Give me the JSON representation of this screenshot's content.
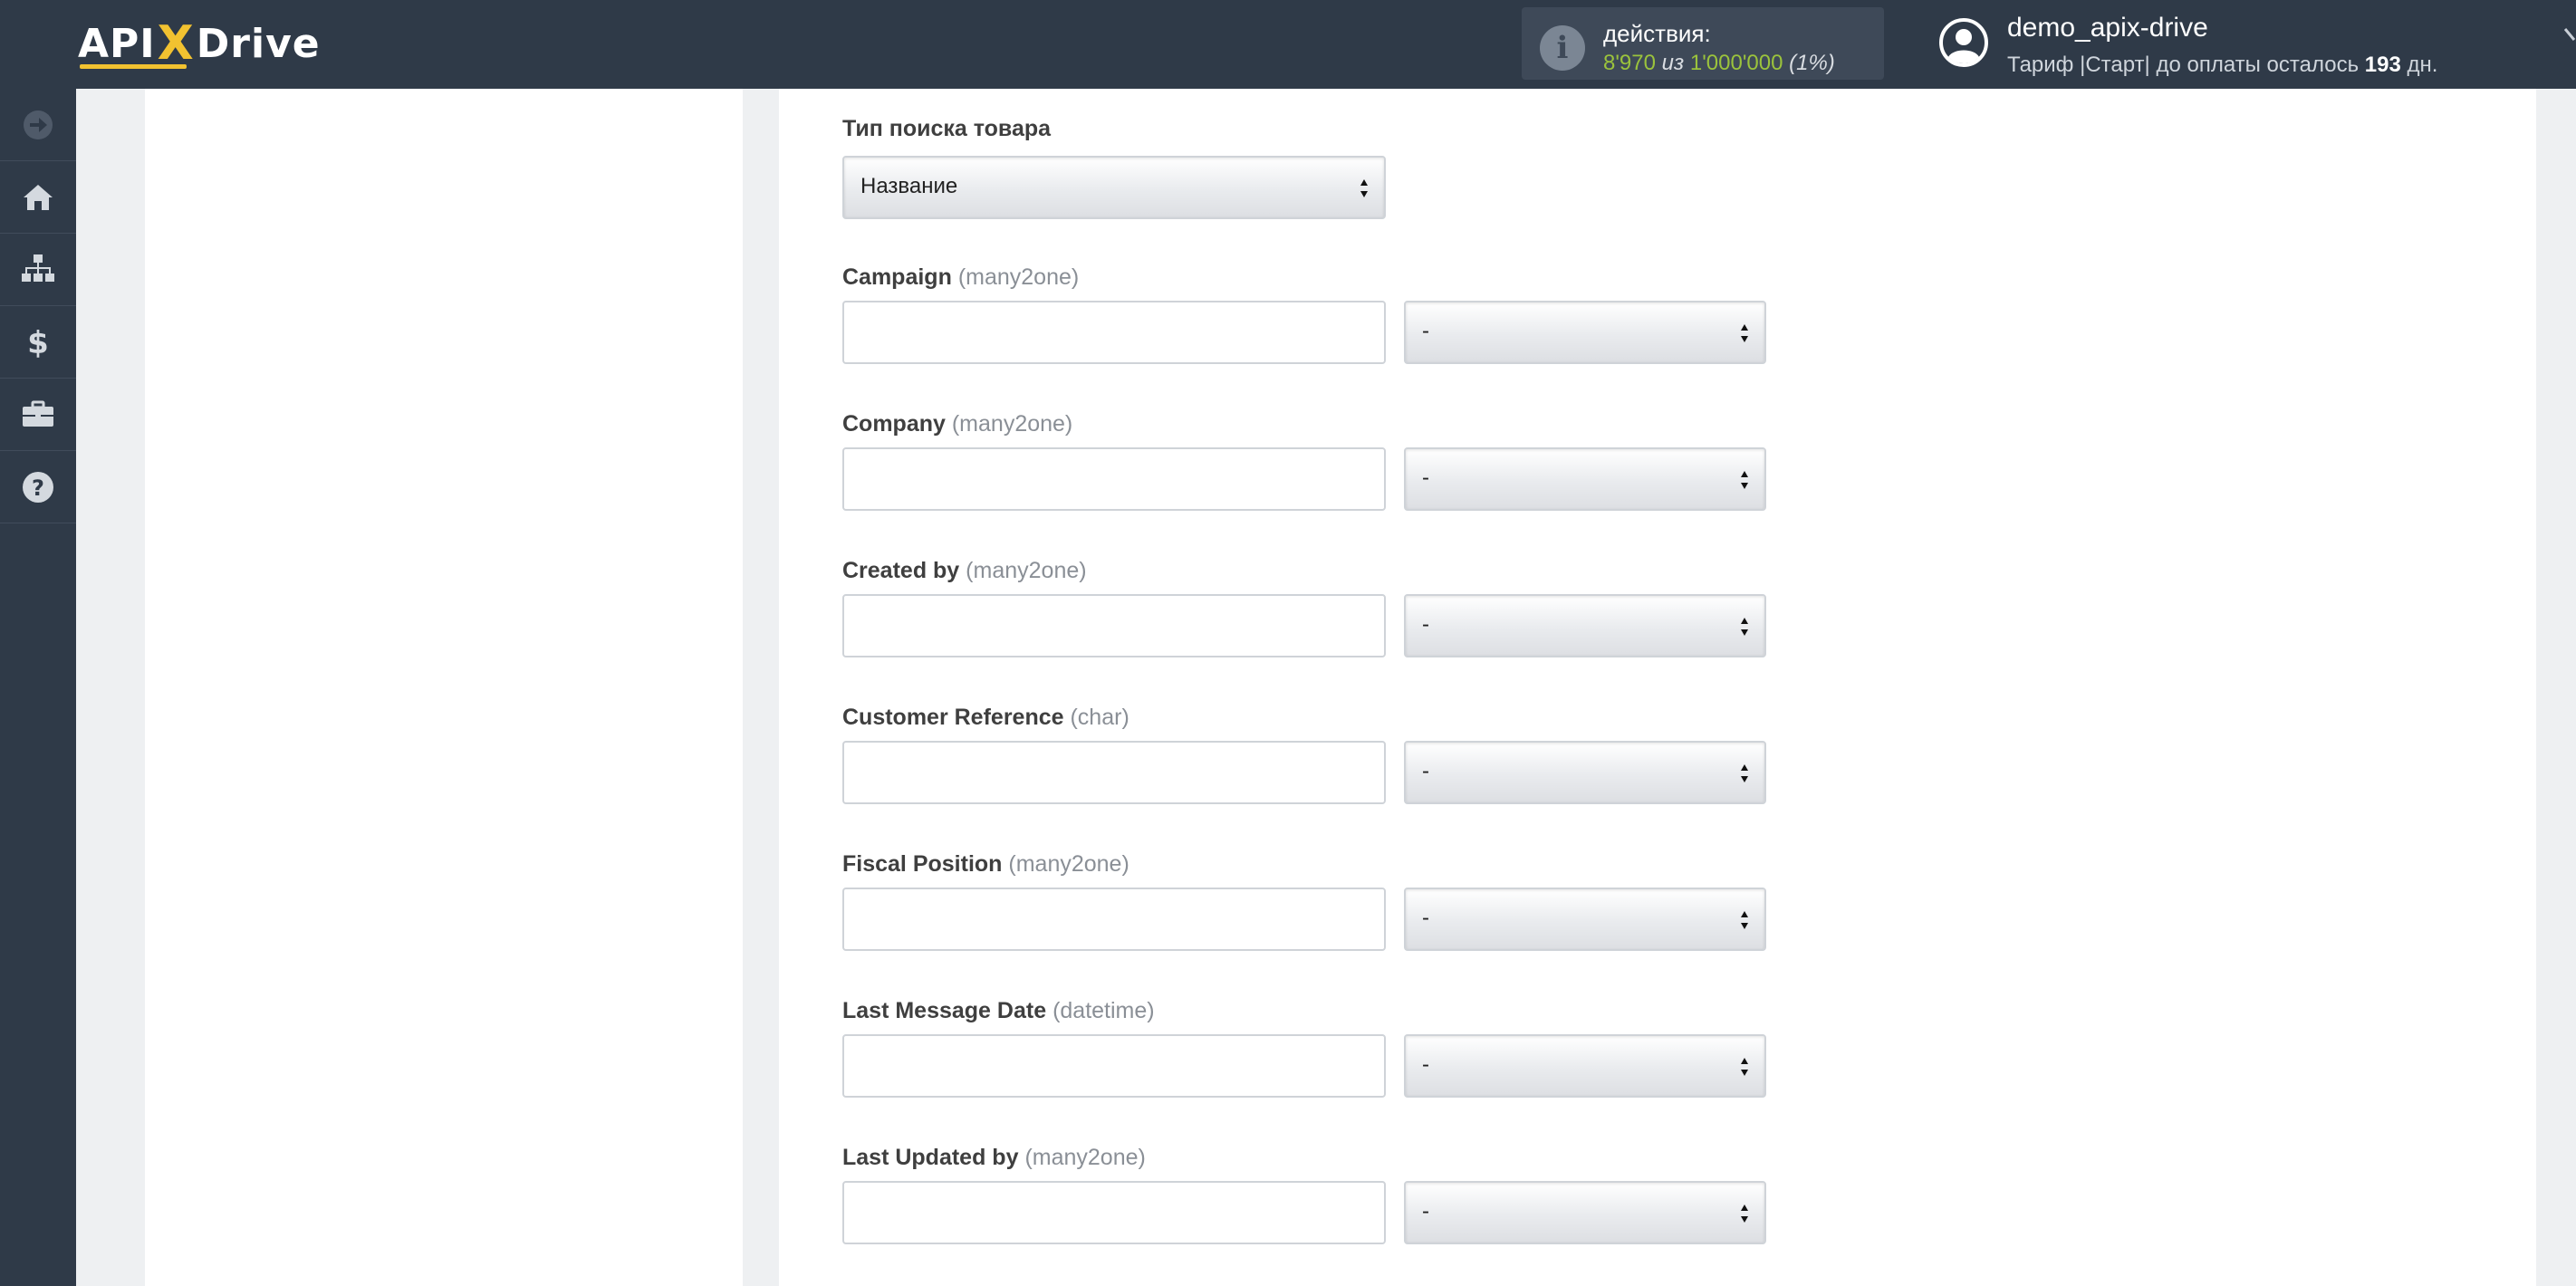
{
  "header": {
    "logo": {
      "part1": "API",
      "x": "X",
      "part2": "Drive"
    },
    "actions": {
      "label": "действия:",
      "used": "8'970",
      "of": "из",
      "total": "1'000'000",
      "percent": "(1%)"
    },
    "user": {
      "name": "demo_apix-drive",
      "tariff_prefix": "Тариф |Старт| до оплаты осталось",
      "days": "193",
      "days_suffix": "дн."
    }
  },
  "sidebar": {
    "items": [
      {
        "icon": "arrow-right-circle-icon"
      },
      {
        "icon": "home-icon"
      },
      {
        "icon": "sitemap-icon"
      },
      {
        "icon": "dollar-icon"
      },
      {
        "icon": "briefcase-icon"
      },
      {
        "icon": "help-circle-icon"
      }
    ]
  },
  "form": {
    "search_type": {
      "label": "Тип поиска товара",
      "value": "Название"
    },
    "fields": [
      {
        "name": "Campaign",
        "type": "(many2one)",
        "value": "",
        "select": "-"
      },
      {
        "name": "Company",
        "type": "(many2one)",
        "value": "",
        "select": "-"
      },
      {
        "name": "Created by",
        "type": "(many2one)",
        "value": "",
        "select": "-"
      },
      {
        "name": "Customer Reference",
        "type": "(char)",
        "value": "",
        "select": "-"
      },
      {
        "name": "Fiscal Position",
        "type": "(many2one)",
        "value": "",
        "select": "-"
      },
      {
        "name": "Last Message Date",
        "type": "(datetime)",
        "value": "",
        "select": "-"
      },
      {
        "name": "Last Updated by",
        "type": "(many2one)",
        "value": "",
        "select": "-"
      }
    ]
  },
  "colors": {
    "topbar": "#2f3a48",
    "accent_yellow": "#f2c230",
    "count_green": "#9bc33c"
  }
}
